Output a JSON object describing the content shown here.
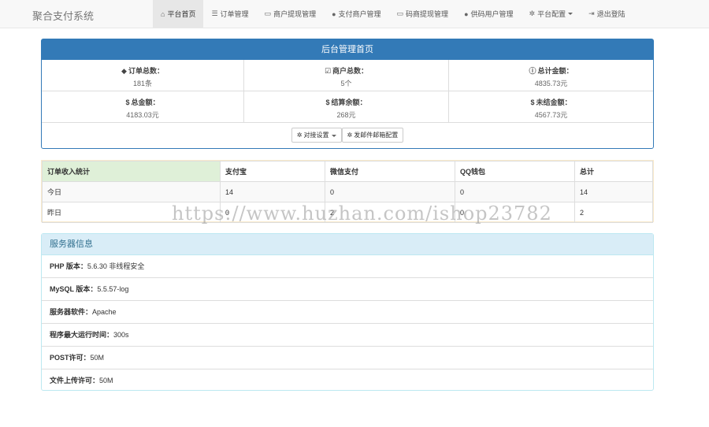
{
  "navbar": {
    "brand": "聚合支付系统",
    "items": [
      {
        "label": "平台首页",
        "icon": "home-icon",
        "glyph": "⌂",
        "active": true
      },
      {
        "label": "订单管理",
        "icon": "list-icon",
        "glyph": "☰"
      },
      {
        "label": "商户提现管理",
        "icon": "credit-card-icon",
        "glyph": "▭"
      },
      {
        "label": "支付商户管理",
        "icon": "user-icon",
        "glyph": "●"
      },
      {
        "label": "码商提现管理",
        "icon": "credit-card-icon",
        "glyph": "▭"
      },
      {
        "label": "供码用户管理",
        "icon": "user-icon",
        "glyph": "●"
      },
      {
        "label": "平台配置",
        "icon": "gear-icon",
        "glyph": "✲",
        "dropdown": true
      },
      {
        "label": "退出登陆",
        "icon": "logout-icon",
        "glyph": "⇥"
      }
    ]
  },
  "dashboard": {
    "title": "后台管理首页",
    "stats": [
      {
        "label": "订单总数：",
        "value": "181条",
        "icon": "tint-icon",
        "glyph": "◆"
      },
      {
        "label": "商户总数：",
        "value": "5个",
        "icon": "check-icon",
        "glyph": "☑"
      },
      {
        "label": "总计金额：",
        "value": "4835.73元",
        "icon": "info-icon",
        "glyph": "ⓘ"
      },
      {
        "label": "总金额：",
        "value": "4183.03元",
        "icon": "dollar-icon",
        "glyph": "$"
      },
      {
        "label": "结算余额：",
        "value": "268元",
        "icon": "dollar-icon",
        "glyph": "$"
      },
      {
        "label": "未结金额：",
        "value": "4567.73元",
        "icon": "dollar-icon",
        "glyph": "$"
      }
    ],
    "buttons": [
      {
        "label": "对接设置",
        "icon": "gear-icon",
        "glyph": "✲",
        "dropdown": true
      },
      {
        "label": "发邮件邮箱配置",
        "icon": "gear-icon",
        "glyph": "✲"
      }
    ]
  },
  "income_table": {
    "headers": [
      "订单收入统计",
      "支付宝",
      "微信支付",
      "QQ钱包",
      "总计"
    ],
    "rows": [
      [
        "今日",
        "14",
        "0",
        "0",
        "14"
      ],
      [
        "昨日",
        "0",
        "2",
        "0",
        "2"
      ]
    ]
  },
  "server_info": {
    "title": "服务器信息",
    "rows": [
      {
        "label": "PHP 版本：",
        "value": "5.6.30 非线程安全"
      },
      {
        "label": "MySQL 版本：",
        "value": "5.5.57-log"
      },
      {
        "label": "服务器软件：",
        "value": "Apache"
      },
      {
        "label": "程序最大运行时间：",
        "value": "300s"
      },
      {
        "label": "POST许可：",
        "value": "50M"
      },
      {
        "label": "文件上传许可：",
        "value": "50M"
      }
    ]
  },
  "watermark": "https://www.huzhan.com/ishop23782"
}
